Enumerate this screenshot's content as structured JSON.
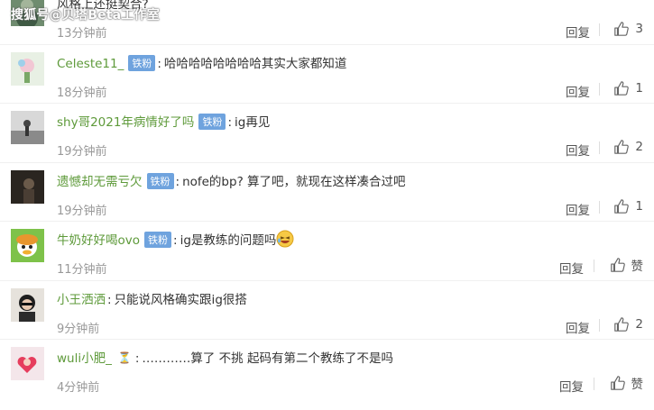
{
  "watermark": "搜狐号@贝塔Beta工作室",
  "comments": [
    {
      "username": "",
      "badge": "",
      "text": "风格上还挺契合?",
      "time": "13分钟前",
      "reply": "回复",
      "likes": "3"
    },
    {
      "username": "Celeste11_",
      "badge": "铁粉",
      "text": "哈哈哈哈哈哈哈哈其实大家都知道",
      "time": "18分钟前",
      "reply": "回复",
      "likes": "1"
    },
    {
      "username": "shy哥2021年病情好了吗",
      "badge": "铁粉",
      "text": "ig再见",
      "time": "19分钟前",
      "reply": "回复",
      "likes": "2"
    },
    {
      "username": "遗憾却无需亏欠",
      "badge": "铁粉",
      "text": "nofe的bp? 算了吧，就现在这样凑合过吧",
      "time": "19分钟前",
      "reply": "回复",
      "likes": "1"
    },
    {
      "username": "牛奶好好喝ovo",
      "badge": "铁粉",
      "text": "ig是教练的问题吗",
      "time": "11分钟前",
      "reply": "回复",
      "likes": "赞"
    },
    {
      "username": "小王洒洒",
      "badge": "",
      "text": "只能说风格确实跟ig很搭",
      "time": "9分钟前",
      "reply": "回复",
      "likes": "2"
    },
    {
      "username": "wuli小肥_",
      "badge": "",
      "text": "…………算了 不挑 起码有第二个教练了不是吗",
      "time": "4分钟前",
      "reply": "回复",
      "likes": "赞"
    }
  ],
  "icons": {
    "like": "thumbs-up-icon",
    "laugh": "laughing-emoji-icon",
    "hourglass": "hourglass-icon"
  },
  "colors": {
    "username": "#5e9a3a",
    "badge": "#6fa3de",
    "meta": "#999999"
  }
}
